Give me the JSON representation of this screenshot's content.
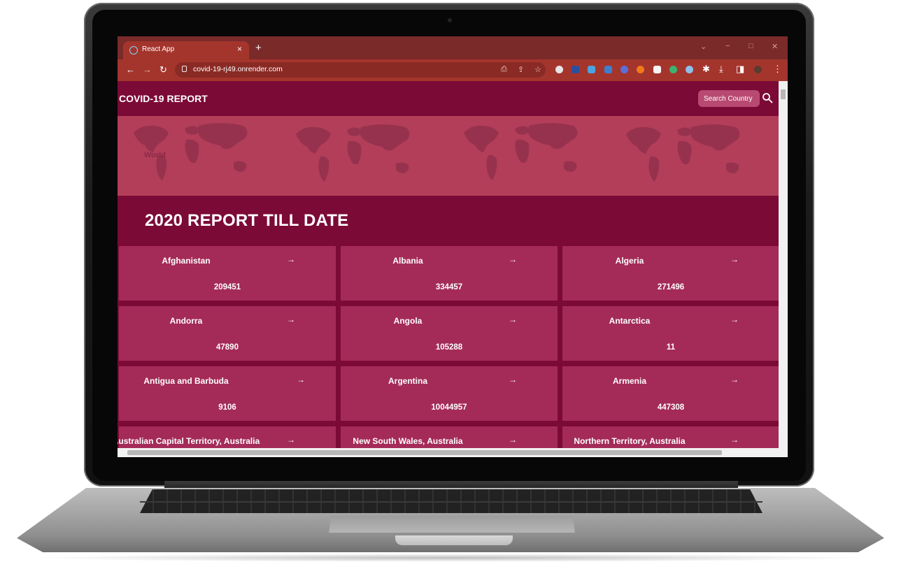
{
  "browser": {
    "tab_title": "React App",
    "tab_close": "×",
    "new_tab": "+",
    "url": "covid-19-rj49.onrender.com",
    "window_controls": [
      "⌄",
      "−",
      "□",
      "✕"
    ]
  },
  "app": {
    "brand": "COVID-19 REPORT",
    "search_placeholder": "Search Country",
    "hero_label": "World",
    "heading": "2020 REPORT TILL DATE",
    "arrow": "→"
  },
  "countries": [
    {
      "name": "Afghanistan",
      "value": "209451"
    },
    {
      "name": "Albania",
      "value": "334457"
    },
    {
      "name": "Algeria",
      "value": "271496"
    },
    {
      "name": "Andorra",
      "value": "47890"
    },
    {
      "name": "Angola",
      "value": "105288"
    },
    {
      "name": "Antarctica",
      "value": "11"
    },
    {
      "name": "Antigua and Barbuda",
      "value": "9106"
    },
    {
      "name": "Argentina",
      "value": "10044957"
    },
    {
      "name": "Armenia",
      "value": "447308"
    },
    {
      "name": "Australian Capital Territory, Australia",
      "value": ""
    },
    {
      "name": "New South Wales, Australia",
      "value": ""
    },
    {
      "name": "Northern Territory, Australia",
      "value": ""
    }
  ],
  "colors": {
    "page_bg": "#7c0a36",
    "card_bg": "#a42b57",
    "hero_bg": "#b33e5a",
    "browser_frame": "#a4352d"
  }
}
